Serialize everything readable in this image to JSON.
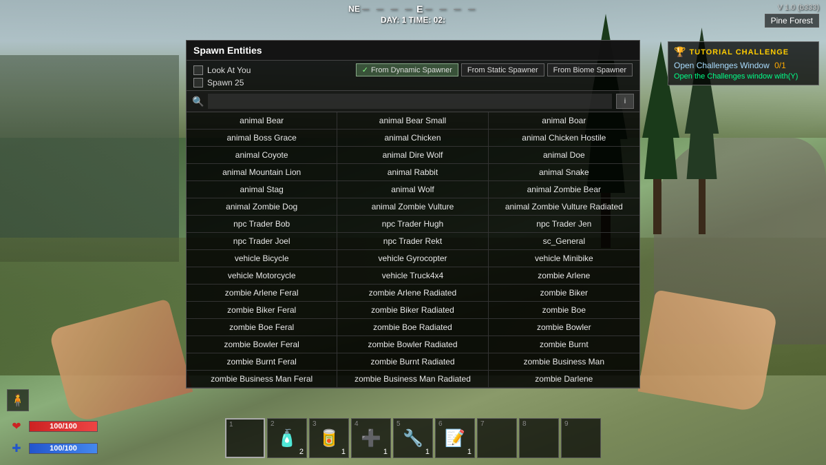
{
  "version": "V 1.0 (b333)",
  "biome": "Pine Forest",
  "compass": {
    "left_marker": "NE",
    "center_marker": "E",
    "dashes_left": "— — — —",
    "dashes_right": "— — — —"
  },
  "day_time": "DAY: 1 TIME: 02:",
  "tutorial": {
    "header": "TUTORIAL CHALLENGE",
    "open_challenges": "Open Challenges Window",
    "count": "0/1",
    "action": "Open the Challenges window with(Y)"
  },
  "spawn_panel": {
    "title": "Spawn Entities",
    "option1": "Look At You",
    "option2": "Spawn 25",
    "btn_dynamic": "From Dynamic Spawner",
    "btn_static": "From Static Spawner",
    "btn_biome": "From Biome Spawner",
    "search_placeholder": "",
    "entities": [
      "animal Bear",
      "animal Bear Small",
      "animal Boar",
      "animal Boss Grace",
      "animal Chicken",
      "animal Chicken Hostile",
      "animal Coyote",
      "animal Dire Wolf",
      "animal Doe",
      "animal Mountain Lion",
      "animal Rabbit",
      "animal Snake",
      "animal Stag",
      "animal Wolf",
      "animal Zombie Bear",
      "animal Zombie Dog",
      "animal Zombie Vulture",
      "animal Zombie Vulture Radiated",
      "npc Trader Bob",
      "npc Trader Hugh",
      "npc Trader Jen",
      "npc Trader Joel",
      "npc Trader Rekt",
      "sc_General",
      "vehicle Bicycle",
      "vehicle Gyrocopter",
      "vehicle Minibike",
      "vehicle Motorcycle",
      "vehicle Truck4x4",
      "zombie Arlene",
      "zombie Arlene Feral",
      "zombie Arlene Radiated",
      "zombie Biker",
      "zombie Biker Feral",
      "zombie Biker Radiated",
      "zombie Boe",
      "zombie Boe Feral",
      "zombie Boe Radiated",
      "zombie Bowler",
      "zombie Bowler Feral",
      "zombie Bowler Radiated",
      "zombie Burnt",
      "zombie Burnt Feral",
      "zombie Burnt Radiated",
      "zombie Business Man",
      "zombie Business Man Feral",
      "zombie Business Man Radiated",
      "zombie Darlene"
    ]
  },
  "hotbar": {
    "slots": [
      {
        "number": "1",
        "icon": "empty",
        "count": ""
      },
      {
        "number": "2",
        "icon": "water",
        "count": "2"
      },
      {
        "number": "3",
        "icon": "food",
        "count": "1"
      },
      {
        "number": "4",
        "icon": "medkit",
        "count": "1"
      },
      {
        "number": "5",
        "icon": "tool",
        "count": "1"
      },
      {
        "number": "6",
        "icon": "note",
        "count": "1"
      },
      {
        "number": "7",
        "icon": "empty",
        "count": ""
      },
      {
        "number": "8",
        "icon": "empty",
        "count": ""
      },
      {
        "number": "9",
        "icon": "empty",
        "count": ""
      }
    ]
  },
  "health": {
    "current": 100,
    "max": 100,
    "label": "100/100"
  },
  "stamina": {
    "current": 100,
    "max": 100,
    "label": "100/100"
  }
}
